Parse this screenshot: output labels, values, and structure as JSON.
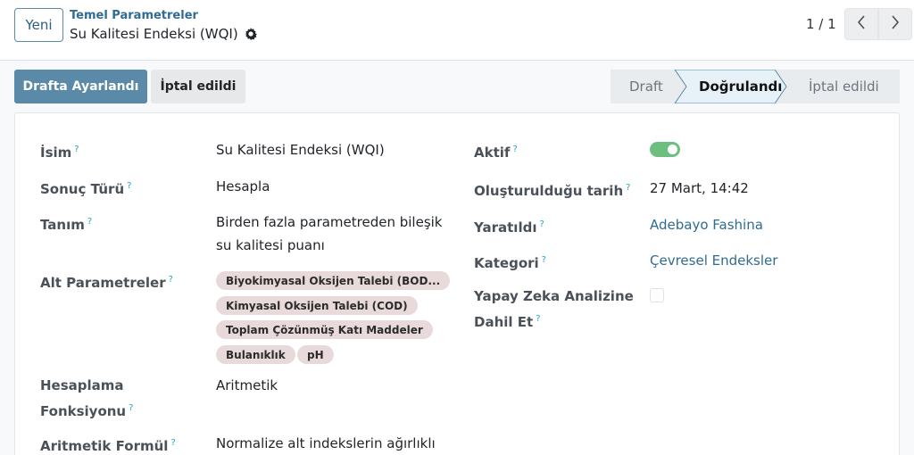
{
  "header": {
    "new_button": "Yeni",
    "breadcrumb_parent": "Temel Parametreler",
    "breadcrumb_current": "Su Kalitesi Endeksi (WQI)",
    "pager": "1 / 1"
  },
  "actions": {
    "primary": "Drafta Ayarlandı",
    "secondary": "İptal edildi"
  },
  "status": {
    "stages": [
      "Draft",
      "Doğrulandı",
      "İptal edildi"
    ],
    "active": "Doğrulandı"
  },
  "form": {
    "name_label": "İsim",
    "name_value": "Su Kalitesi Endeksi (WQI)",
    "result_type_label": "Sonuç Türü",
    "result_type_value": "Hesapla",
    "description_label": "Tanım",
    "description_line1": "Birden fazla parametreden bileşik",
    "description_line2": "su kalitesi puanı",
    "sub_params_label": "Alt Parametreler",
    "sub_params": [
      "Biyokimyasal Oksijen Talebi (BOD...",
      "Kimyasal Oksijen Talebi (COD)",
      "Toplam Çözünmüş Katı Maddeler",
      "Bulanıklık",
      "pH"
    ],
    "calc_func_label_line1": "Hesaplama",
    "calc_func_label_line2": "Fonksiyonu",
    "calc_func_value": "Aritmetik",
    "formula_label": "Aritmetik Formül",
    "formula_value": "Normalize alt indekslerin ağırlıklı",
    "active_label": "Aktif",
    "active_value": true,
    "created_date_label": "Oluşturulduğu tarih",
    "created_date_value": "27 Mart, 14:42",
    "created_by_label": "Yaratıldı",
    "created_by_value": "Adebayo Fashina",
    "category_label": "Kategori",
    "category_value": "Çevresel Endeksler",
    "ai_label_line1": "Yapay Zeka Analizine",
    "ai_label_line2": "Dahil Et",
    "ai_value": false,
    "help_mark": "?"
  },
  "colors": {
    "primary": "#5b8aa8",
    "link": "#2f6b94",
    "toggle_on": "#6cbf7f",
    "tag_bg": "#e8dada",
    "help": "#27a3c5"
  }
}
